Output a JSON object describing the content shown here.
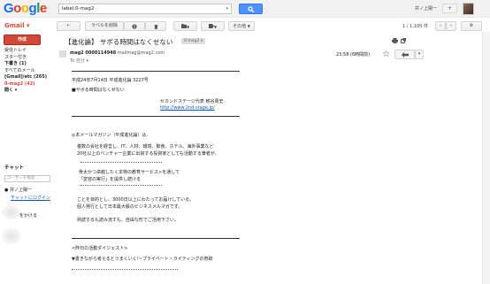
{
  "header": {
    "logo": [
      "G",
      "o",
      "o",
      "g",
      "l",
      "e"
    ],
    "logo_colors": [
      "#1a6af3",
      "#e33c2b",
      "#f4b400",
      "#1a6af3",
      "#0f9d58",
      "#e33c2b"
    ],
    "search_value": "label:0-mag2",
    "user_name": "井ノ上陽一",
    "plus_label": "+"
  },
  "toolbar": {
    "app_label": "Gmail",
    "back_label": "←",
    "remove_label_btn": "ラベルを削除",
    "spam_btn": "!",
    "delete_btn": "🗑",
    "move_btn": "▼",
    "labels_btn": "▼",
    "more_btn": "その他",
    "page_range": "1 / 1,105 件",
    "prev_btn": "‹",
    "next_btn": "›",
    "settings_btn": "⚙"
  },
  "sidebar": {
    "compose": "作成",
    "items": [
      {
        "label": "受信トレイ",
        "style": "normal"
      },
      {
        "label": "スター付き",
        "style": "normal"
      },
      {
        "label": "下書き (1)",
        "style": "bold"
      },
      {
        "label": "すべてのメール",
        "style": "normal"
      },
      {
        "label": "[Gmail]/etc (265)",
        "style": "bold"
      },
      {
        "label": "0-mag2 (42)",
        "style": "red"
      },
      {
        "label": "開く ▾",
        "style": "bold"
      }
    ],
    "chat_title": "チャット",
    "chat_search_placeholder": "ユーザーを検索...",
    "chat_user": "● 井ノ上陽一",
    "chat_invite": "チャットにログイン",
    "chat_invite2": "",
    "chat_item3": "をかける"
  },
  "message": {
    "subject": "【進化論】 サボる時間はなくせない",
    "label_chip": "0-mag2 x",
    "sender_name": "mag2 0000114948",
    "sender_email": "mailmag@mag2.com",
    "to_line": "To 自分 ▾",
    "time": "23:58 (6時間前)",
    "body_lines": [
      "平成24年7月14日 平成進化論 3227号",
      "■サボる時間はなくせない",
      "セカンドステージ代表 鮒谷周史",
      "http://www.2nd-stage.jp/",
      "◎本メールマガジン（平成進化論）は、",
      "複数の会社を経営し、IT、人材、環境、飲食、ホテル、海外事業など",
      "20社以上のベンチャー企業に出資する投資家としても活動する筆者が、",
      "骨太かつ卓越したく本物の教育サービス>を通して",
      "「変容の実行」を提供し続ける",
      "ことを目的とし、3000日以上にわたってお届けしている、",
      "個人発行として日本最大級のビジネスメルマガです。",
      "熟読するも読み流すも、自由な形でご活用下さい。",
      "<昨日の活動ダイジェスト>",
      "▼書きながら考えるとうまくいく!~プライベート・ライティングの奇跡"
    ]
  }
}
